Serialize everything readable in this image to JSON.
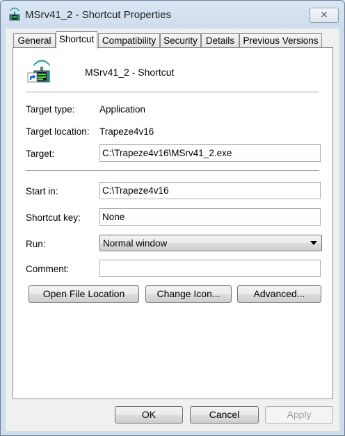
{
  "window": {
    "title": "MSrv41_2 - Shortcut Properties",
    "close_label": "✕"
  },
  "tabs": [
    {
      "label": "General",
      "active": false
    },
    {
      "label": "Shortcut",
      "active": true
    },
    {
      "label": "Compatibility",
      "active": false
    },
    {
      "label": "Security",
      "active": false
    },
    {
      "label": "Details",
      "active": false
    },
    {
      "label": "Previous Versions",
      "active": false
    }
  ],
  "shortcut": {
    "name": "MSrv41_2 - Shortcut",
    "target_type_label": "Target type:",
    "target_type": "Application",
    "target_location_label": "Target location:",
    "target_location": "Trapeze4v16",
    "target_label": "Target:",
    "target": "C:\\Trapeze4v16\\MSrv41_2.exe",
    "start_in_label": "Start in:",
    "start_in": "C:\\Trapeze4v16",
    "shortcut_key_label": "Shortcut key:",
    "shortcut_key": "None",
    "run_label": "Run:",
    "run": "Normal window",
    "comment_label": "Comment:",
    "comment": ""
  },
  "actions": {
    "open_file_location": "Open File Location",
    "change_icon": "Change Icon...",
    "advanced": "Advanced..."
  },
  "footer": {
    "ok": "OK",
    "cancel": "Cancel",
    "apply": "Apply",
    "apply_enabled": false
  },
  "icons": {
    "app": "network-server-app-icon",
    "shortcut_overlay": "shortcut-arrow-icon"
  }
}
